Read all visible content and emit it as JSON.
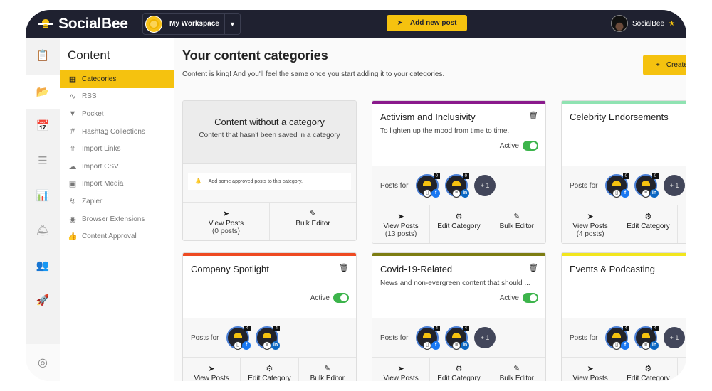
{
  "app": {
    "name": "SocialBee"
  },
  "topbar": {
    "workspace_name": "My Workspace",
    "add_post_label": "Add new post",
    "user_name": "SocialBee"
  },
  "rail": {
    "items": [
      {
        "icon": "clipboard-icon"
      },
      {
        "icon": "folder-open-icon",
        "active": true
      },
      {
        "icon": "calendar-icon"
      },
      {
        "icon": "list-icon"
      },
      {
        "icon": "analytics-icon"
      },
      {
        "icon": "bell-service-icon"
      },
      {
        "icon": "users-icon"
      },
      {
        "icon": "rocket-icon"
      }
    ],
    "bottom_icon": "lifebuoy-icon"
  },
  "subnav": {
    "title": "Content",
    "items": [
      {
        "label": "Categories",
        "icon": "grid-icon",
        "active": true
      },
      {
        "label": "RSS",
        "icon": "rss-icon"
      },
      {
        "label": "Pocket",
        "icon": "pocket-icon"
      },
      {
        "label": "Hashtag Collections",
        "icon": "hashtag-icon"
      },
      {
        "label": "Import Links",
        "icon": "upload-icon"
      },
      {
        "label": "Import CSV",
        "icon": "cloud-upload-icon"
      },
      {
        "label": "Import Media",
        "icon": "image-icon"
      },
      {
        "label": "Zapier",
        "icon": "bolt-icon"
      },
      {
        "label": "Browser Extensions",
        "icon": "chrome-icon"
      },
      {
        "label": "Content Approval",
        "icon": "thumbs-up-icon"
      }
    ]
  },
  "main": {
    "title": "Your content categories",
    "subtitle": "Content is king! And you'll feel the same once you start adding it to your categories.",
    "create_label": "Create"
  },
  "no_category_card": {
    "title": "Content without a category",
    "description": "Content that hasn't been saved in a category",
    "note": "Add some approved posts to this category.",
    "view_posts": "View Posts",
    "post_count": "(0 posts)",
    "bulk_editor": "Bulk Editor"
  },
  "labels": {
    "active": "Active",
    "posts_for": "Posts for",
    "view_posts": "View Posts",
    "edit_category": "Edit Category",
    "bulk_editor": "Bulk Editor"
  },
  "categories": [
    {
      "name": "Activism and Inclusivity",
      "description": "To lighten up the mood from time to time.",
      "color": "#8a1a8c",
      "active": true,
      "post_count": "(13 posts)",
      "accounts": [
        {
          "count": "0",
          "network": "f"
        },
        {
          "count": "0",
          "network": "in"
        }
      ],
      "extra": "+ 1"
    },
    {
      "name": "Celebrity Endorsements",
      "description": "",
      "color": "#8fe3b2",
      "active": true,
      "post_count": "(4 posts)",
      "accounts": [
        {
          "count": "0",
          "network": "f"
        },
        {
          "count": "0",
          "network": "in"
        }
      ],
      "extra": "+ 1"
    },
    {
      "name": "Company Spotlight",
      "description": "",
      "color": "#ee4a22",
      "active": true,
      "post_count": "",
      "accounts": [
        {
          "count": "4",
          "network": "f"
        },
        {
          "count": "4",
          "network": "in"
        }
      ],
      "extra": ""
    },
    {
      "name": "Covid-19-Related",
      "description": "News and non-evergreen content that should ...",
      "color": "#7d7d12",
      "active": true,
      "post_count": "",
      "accounts": [
        {
          "count": "4",
          "network": "f"
        },
        {
          "count": "4",
          "network": "in"
        }
      ],
      "extra": "+ 1"
    },
    {
      "name": "Events & Podcasting",
      "description": "",
      "color": "#f2e61e",
      "active": true,
      "post_count": "",
      "accounts": [
        {
          "count": "4",
          "network": "f"
        },
        {
          "count": "4",
          "network": "in"
        }
      ],
      "extra": "+ 1"
    }
  ],
  "colors": {
    "brand_yellow": "#f5c20f",
    "topbar": "#1f2130",
    "toggle_on": "#3cb44b",
    "facebook": "#1877f2",
    "linkedin": "#0a66c2"
  }
}
